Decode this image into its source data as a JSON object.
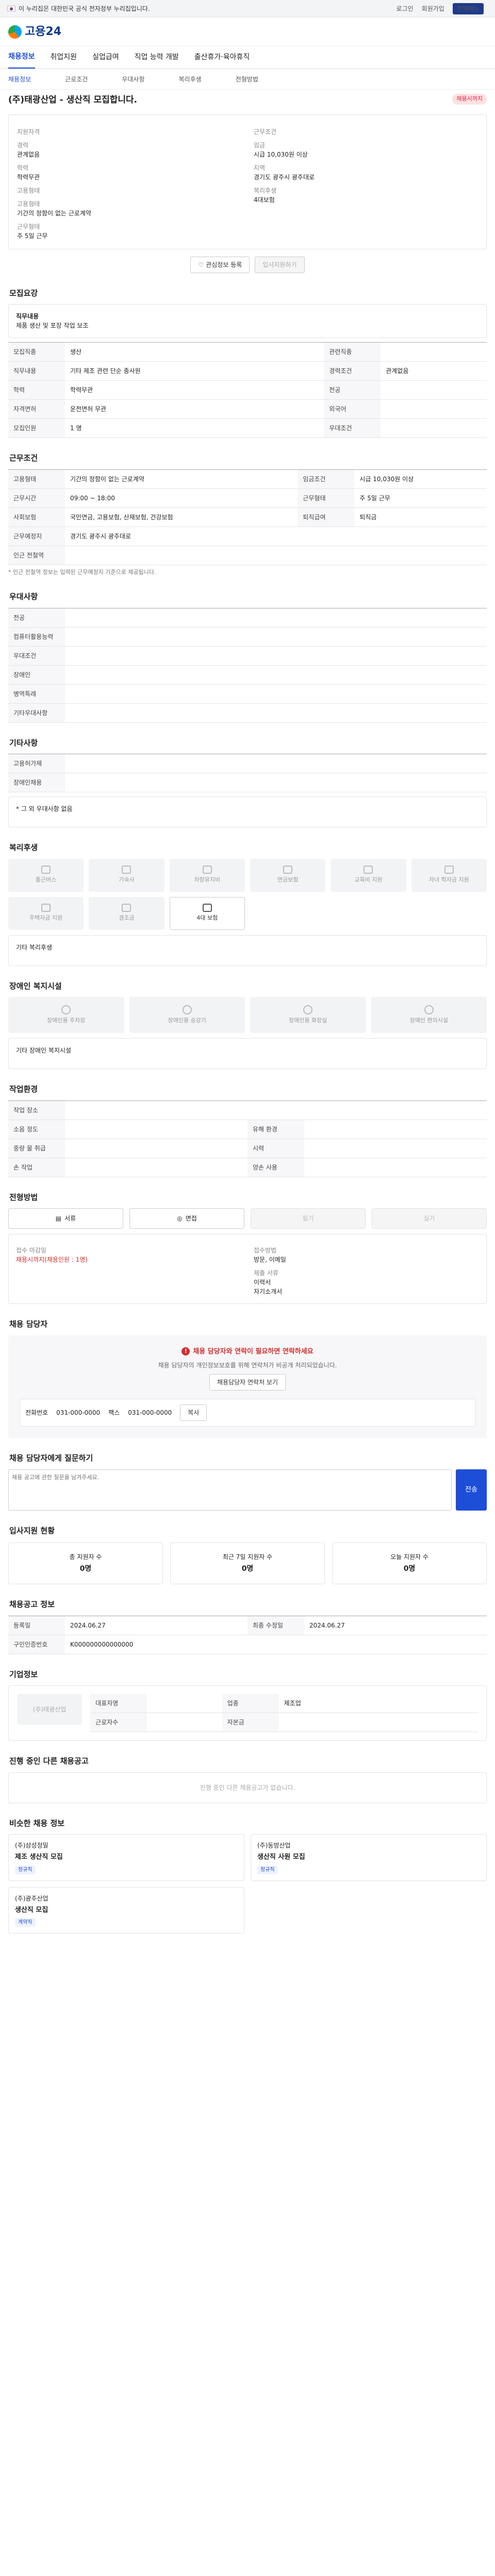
{
  "topbar": {
    "notice": "이 누리집은 대한민국 공식 전자정부 누리집입니다.",
    "links": [
      "로그인",
      "회원가입"
    ],
    "sec_label": "전체메뉴"
  },
  "header": {
    "logo": "고용24"
  },
  "gnb": [
    "채용정보",
    "취업지원",
    "실업급여",
    "직업 능력 개발",
    "출산휴가·육아휴직"
  ],
  "subnav": [
    "채용정보",
    "근로조건",
    "우대사항",
    "복리후생",
    "전형방법"
  ],
  "job": {
    "title": "(주)태광산업 - 생산직 모집합니다.",
    "badge": "채용시까지",
    "left": [
      {
        "k": "지원자격",
        "v": ""
      },
      {
        "k": "경력",
        "v": "관계없음"
      },
      {
        "k": "학력",
        "v": "학력무관"
      },
      {
        "k": "고용형태",
        "v": ""
      },
      {
        "k": "고용형태",
        "v": "기간의 정함이 없는 근로계약"
      },
      {
        "k": "근무형태",
        "v": "주 5일 근무"
      }
    ],
    "right": [
      {
        "k": "근무조건",
        "v": ""
      },
      {
        "k": "임금",
        "v": "시급 10,030원 이상"
      },
      {
        "k": "지역",
        "v": "경기도 광주시 광주대로"
      },
      {
        "k": "복리후생",
        "v": ""
      },
      {
        "k": "",
        "v": "4대보험"
      }
    ]
  },
  "actions": {
    "save": "관심정보 등록",
    "apply": "입사지원하기"
  },
  "recruit": {
    "title": "모집요강",
    "job_title": "직무내용",
    "job_desc": "제품 생산 및 포장 작업 보조",
    "rows": [
      {
        "k": "모집직종",
        "v": "생산",
        "k2": "관련직종",
        "v2": ""
      },
      {
        "k": "직무내용",
        "v": "기타 제조 관련 단순 종사원",
        "k2": "경력조건",
        "v2": "관계없음"
      },
      {
        "k": "학력",
        "v": "학력무관",
        "k2": "전공",
        "v2": ""
      },
      {
        "k": "자격면허",
        "v": "운전면허 무관",
        "k2": "외국어",
        "v2": ""
      },
      {
        "k": "모집인원",
        "v": "1 명",
        "k2": "우대조건",
        "v2": ""
      }
    ]
  },
  "cond": {
    "title": "근무조건",
    "rows": [
      {
        "k": "고용형태",
        "v": "기간의 정함이 없는 근로계약",
        "k2": "임금조건",
        "v2": "시급 10,030원 이상"
      },
      {
        "k": "근무시간",
        "v": "09:00 ~ 18:00",
        "k2": "근무형태",
        "v2": "주 5일 근무"
      },
      {
        "k": "사회보험",
        "v": "국민연금, 고용보험, 산재보험, 건강보험",
        "k2": "퇴직급여",
        "v2": "퇴직금"
      },
      {
        "k": "근무예정지",
        "v": "경기도 광주시 광주대로",
        "k2": "",
        "v2": ""
      },
      {
        "k": "인근 전철역",
        "v": "",
        "k2": "",
        "v2": ""
      }
    ],
    "note": "* 인근 전철역 정보는 입력된 근무예정지 기준으로 제공됩니다."
  },
  "pref": {
    "title": "우대사항",
    "rows": [
      {
        "k": "전공",
        "v": ""
      },
      {
        "k": "컴퓨터활용능력",
        "v": ""
      },
      {
        "k": "우대조건",
        "v": ""
      },
      {
        "k": "장애인",
        "v": ""
      },
      {
        "k": "병역특례",
        "v": ""
      },
      {
        "k": "기타우대사항",
        "v": ""
      }
    ]
  },
  "etc": {
    "title": "기타사항",
    "rows": [
      {
        "k": "고용허가제",
        "v": ""
      },
      {
        "k": "장애인채용",
        "v": ""
      }
    ],
    "note": "* 그 외 우대사항 없음"
  },
  "welfare": {
    "title": "복리후생",
    "items": [
      "통근버스",
      "기숙사",
      "차량유지비",
      "연금보험",
      "교육비 지원",
      "자녀 학자금 지원",
      "주택자금 지원",
      "경조금",
      "4대 보험"
    ],
    "other_title": "기타 복리후생"
  },
  "facility": {
    "title": "장애인 복지시설",
    "items": [
      "장애인용 주차장",
      "장애인용 승강기",
      "장애인용 화장실",
      "장애인 편의시설"
    ],
    "other": "기타 장애인 복지시설"
  },
  "workenv": {
    "title": "작업환경",
    "rows": [
      {
        "k": "작업 장소",
        "v": "",
        "k2": "",
        "v2": ""
      },
      {
        "k": "소음 정도",
        "v": "",
        "k2": "유해 환경",
        "v2": ""
      },
      {
        "k": "중량 물 취급",
        "v": "",
        "k2": "시력",
        "v2": ""
      },
      {
        "k": "손 작업",
        "v": "",
        "k2": "양손 사용",
        "v2": ""
      }
    ]
  },
  "process": {
    "title": "전형방법",
    "methods": [
      "서류",
      "면접",
      "필기",
      "실기"
    ],
    "apply_title": "접수 마감일",
    "deadline": "채용시까지(채용인원 : 1명)",
    "docs_title": "제출 서류",
    "docs": [
      "이력서",
      "자기소개서"
    ],
    "contact_title": "접수방법",
    "contact": "방문, 이메일"
  },
  "manager": {
    "title": "채용 담당자",
    "alert": "채용 담당자와 연락이 필요하면 연락하세요",
    "desc": "채용 담당자의 개인정보보호를 위해 연락처가 비공개 처리되었습니다.",
    "btn": "채용담당자 연락처 보기",
    "phone_k": "전화번호",
    "phone": "031-000-0000",
    "fax_k": "팩스",
    "fax": "031-000-0000",
    "copy": "복사"
  },
  "qa": {
    "title": "채용 담당자에게 질문하기",
    "placeholder": "채용 공고에 관한 질문을 남겨주세요.",
    "send": "전송"
  },
  "stat": {
    "title": "입사지원 현황",
    "items": [
      {
        "k": "총 지원자 수",
        "v": "0명"
      },
      {
        "k": "최근 7일 지원자 수",
        "v": "0명"
      },
      {
        "k": "오늘 지원자 수",
        "v": "0명"
      }
    ]
  },
  "info": {
    "title": "채용공고 정보",
    "rows": [
      {
        "k": "등록일",
        "v": "2024.06.27",
        "k2": "최종 수정일",
        "v2": "2024.06.27"
      },
      {
        "k": "구인인증번호",
        "v": "K000000000000000",
        "k2": "",
        "v2": ""
      }
    ]
  },
  "company": {
    "title": "기업정보",
    "name": "(주)태광산업",
    "rows": [
      {
        "k": "대표자명",
        "v": "",
        "k2": "업종",
        "v2": "제조업"
      },
      {
        "k": "근로자수",
        "v": "",
        "k2": "자본금",
        "v2": ""
      }
    ]
  },
  "others": {
    "title": "진행 중인 다른 채용공고",
    "empty": "진행 중인 다른 채용공고가 없습니다."
  },
  "recommend": {
    "title": "비슷한 채용 정보",
    "items": [
      {
        "company": "(주)삼성정밀",
        "title": "제조 생산직 모집",
        "tag": "정규직"
      },
      {
        "company": "(주)동방산업",
        "title": "생산직 사원 모집",
        "tag": "정규직"
      },
      {
        "company": "(주)광주산업",
        "title": "생산직 모집",
        "tag": "계약직"
      }
    ]
  }
}
